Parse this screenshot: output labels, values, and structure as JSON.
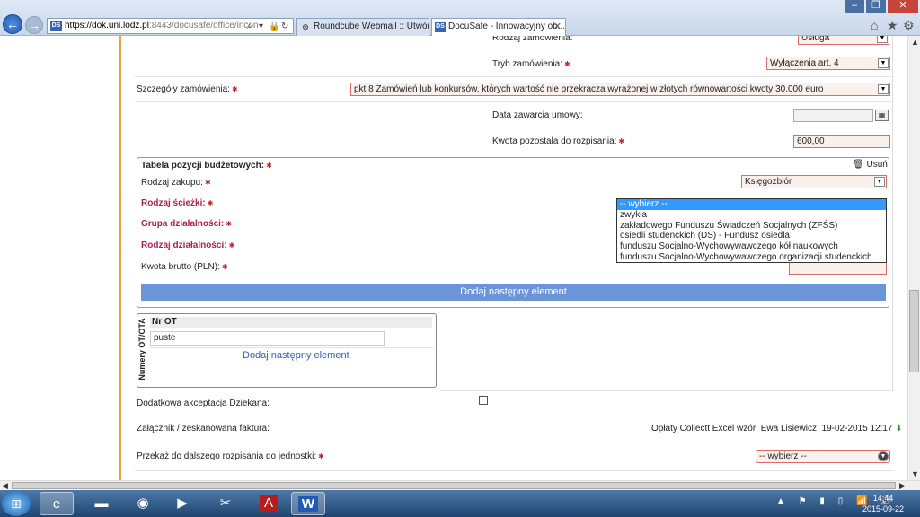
{
  "browser": {
    "url_domain": "https://dok.uni.lodz.pl",
    "url_rest": ":8443/docusafe/office/incon",
    "tabs": [
      {
        "label": "Roundcube Webmail :: Utwór..."
      },
      {
        "label": "DocuSafe - Innowacyjny ob..."
      }
    ],
    "window_controls": {
      "minimize": "–",
      "maximize": "❐",
      "close": "✕"
    }
  },
  "form": {
    "rodzaj_zamowienia": {
      "label": "Rodzaj zamówienia:",
      "value": "Usługa"
    },
    "tryb_zamowienia": {
      "label": "Tryb zamówienia:",
      "value": "Wyłączenia art. 4"
    },
    "szczegoly": {
      "label": "Szczegóły zamówienia:",
      "value": "pkt 8 Zamówień lub konkursów, których wartość nie przekracza wyrażonej w złotych równowartości kwoty 30.000 euro"
    },
    "data_zawarcia": {
      "label": "Data zawarcia umowy:",
      "value": ""
    },
    "kwota_pozostala": {
      "label": "Kwota pozostała do rozpisania:",
      "value": "600,00"
    },
    "budget_table": {
      "title": "Tabela pozycji budżetowych:",
      "remove_label": "Usuń",
      "rodzaj_zakupu": {
        "label": "Rodzaj zakupu:",
        "value": "Księgozbiór"
      },
      "rodzaj_sciezki": {
        "label": "Rodzaj ścieżki:"
      },
      "grupa_dzialalnosci": {
        "label": "Grupa działalności:"
      },
      "rodzaj_dzialalnosci": {
        "label": "Rodzaj działalności:"
      },
      "kwota_brutto": {
        "label": "Kwota brutto (PLN):"
      },
      "dropdown_options": [
        "-- wybierz --",
        "zwykła",
        "zakładowego Funduszu Świadczeń Socjalnych (ZFŚS)",
        "osiedli studenckich (DS) - Fundusz osiedla",
        "funduszu Socjalno-Wychowywawczego kół naukowych",
        "funduszu Socjalno-Wychowywawczego organizacji studenckich"
      ],
      "add_button": "Dodaj następny element"
    },
    "ot_table": {
      "side_label": "Numery OT/OTA",
      "header": "Nr OT",
      "value": "puste",
      "add_link": "Dodaj następny element"
    },
    "dodatkowa_akceptacja": {
      "label": "Dodatkowa akceptacja Dziekana:",
      "checked": false
    },
    "zalacznik": {
      "label": "Załącznik / zeskanowana faktura:",
      "file": "Opłaty Collectt Excel wzór",
      "author": "Ewa Lisiewicz",
      "date": "19-02-2015 12:17"
    },
    "przekaz": {
      "label": "Przekaż do dalszego rozpisania do jednostki:",
      "value": "-- wybierz --"
    }
  },
  "taskbar": {
    "clock_time": "14:44",
    "clock_date": "2015-09-22",
    "tray": "▲ ⚑ ▮ ▯ 📶 🔊"
  },
  "colors": {
    "accent": "#6c94d9",
    "required": "#c0202a",
    "section_red": "#b0204c",
    "orange_line": "#e8a33c"
  }
}
